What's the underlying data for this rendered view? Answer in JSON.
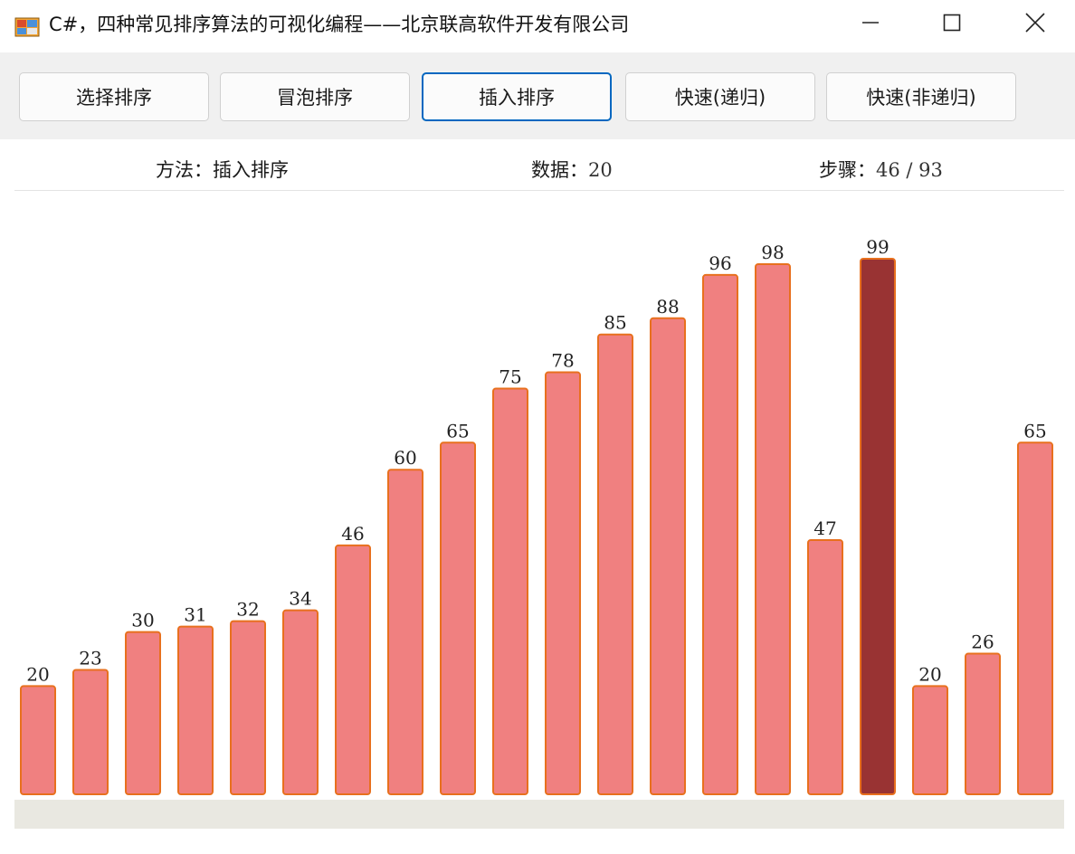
{
  "window": {
    "title": "C#，四种常见排序算法的可视化编程——北京联高软件开发有限公司"
  },
  "toolbar": {
    "buttons": [
      {
        "label": "选择排序",
        "active": false
      },
      {
        "label": "冒泡排序",
        "active": false
      },
      {
        "label": "插入排序",
        "active": true
      },
      {
        "label": "快速(递归)",
        "active": false
      },
      {
        "label": "快速(非递归)",
        "active": false
      }
    ]
  },
  "info": {
    "method_label": "方法：",
    "method_value": "插入排序",
    "data_label": "数据：",
    "data_value": "20",
    "step_label": "步骤：",
    "step_value": "46 / 93"
  },
  "colors": {
    "bar_fill": "#f08080",
    "bar_stroke": "#e8701e",
    "highlight_fill": "#993333",
    "label_color": "#222222"
  },
  "chart_data": {
    "type": "bar",
    "values": [
      20,
      23,
      30,
      31,
      32,
      34,
      46,
      60,
      65,
      75,
      78,
      85,
      88,
      96,
      98,
      47,
      99,
      20,
      26,
      65
    ],
    "highlight_index": 16,
    "ylim": [
      0,
      100
    ]
  }
}
